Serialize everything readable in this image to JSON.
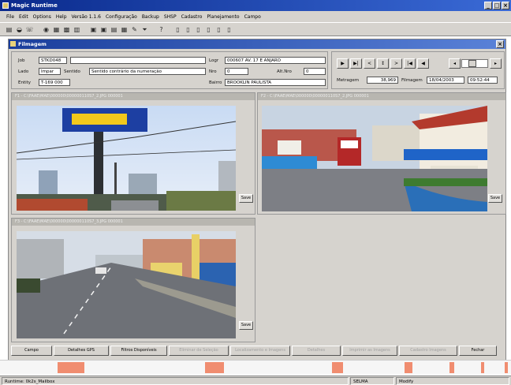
{
  "window": {
    "title": "Magic Runtime"
  },
  "menu": [
    "File",
    "Edit",
    "Options",
    "Help",
    "Versão 1.1.6",
    "Configuração",
    "Backup",
    "SHSP",
    "Cadastro",
    "Planejamento",
    "Campo"
  ],
  "child": {
    "title": "Filmagem"
  },
  "info": {
    "job_label": "Job",
    "job_value": "STKD048",
    "lado_label": "Lado",
    "lado_value": "Impar",
    "sentido_label": "Sentido",
    "sentido_value": "Sentido contrário da numeração",
    "entity_label": "Entity",
    "entity_value": "T-169 000",
    "logr_label": "Logr",
    "logr_value": "000607  AV. 17 E ANJARO",
    "nro_label": "Nro",
    "nro_value": "0",
    "altnro_label": "Alt.Nro",
    "altnro_value": "0",
    "bairro_label": "Bairro",
    "bairro_value": "BROOKLIN PAULISTA"
  },
  "nav": {
    "buttons": [
      "▶",
      "▶|",
      "<",
      "↕",
      ">",
      "|◀",
      "◀"
    ],
    "metragem_label": "Metragem",
    "metragem_value": "38,969",
    "filmagem_label": "Filmagem",
    "filmagem_date": "18/04/2003",
    "filmagem_time": "09:52:44"
  },
  "panes": [
    {
      "title": "F1 - C:\\FAAE\\MAE\\000000\\000000110S7_2.JPG   000001",
      "save_label": "Save"
    },
    {
      "title": "F2 - C:\\FAAE\\MAE\\000000\\000000110S7_2.JPG   000001",
      "save_label": "Save"
    },
    {
      "title": "F3 - C:\\FAAE\\MAE\\000000\\000000110S7_3.JPG   000001",
      "save_label": "Save"
    }
  ],
  "bottom_buttons": [
    {
      "label": "Campo",
      "enabled": true
    },
    {
      "label": "Detalhes GPS",
      "enabled": true
    },
    {
      "label": "Filtros Disponíveis",
      "enabled": true
    },
    {
      "label": "Eliminar de Seleção",
      "enabled": false
    },
    {
      "label": "Localizamento e Imagens",
      "enabled": false
    },
    {
      "label": "Detalhes",
      "enabled": false
    },
    {
      "label": "Imprimir as Imagens",
      "enabled": false
    },
    {
      "label": "Cadastro Imagens",
      "enabled": false
    },
    {
      "label": "Fechar",
      "enabled": true
    }
  ],
  "timeline": {
    "marks": [
      0.139,
      0.42,
      0.66,
      0.8,
      0.885,
      0.945,
      0.99
    ]
  },
  "status": {
    "left": "Runtime: 0k2s_Mailbox",
    "middle": "SELMA",
    "right": "Modify"
  },
  "colors": {
    "titlebar": "#0a2a8c",
    "timeline_mark": "#f08d70",
    "face": "#d6d3ce"
  }
}
